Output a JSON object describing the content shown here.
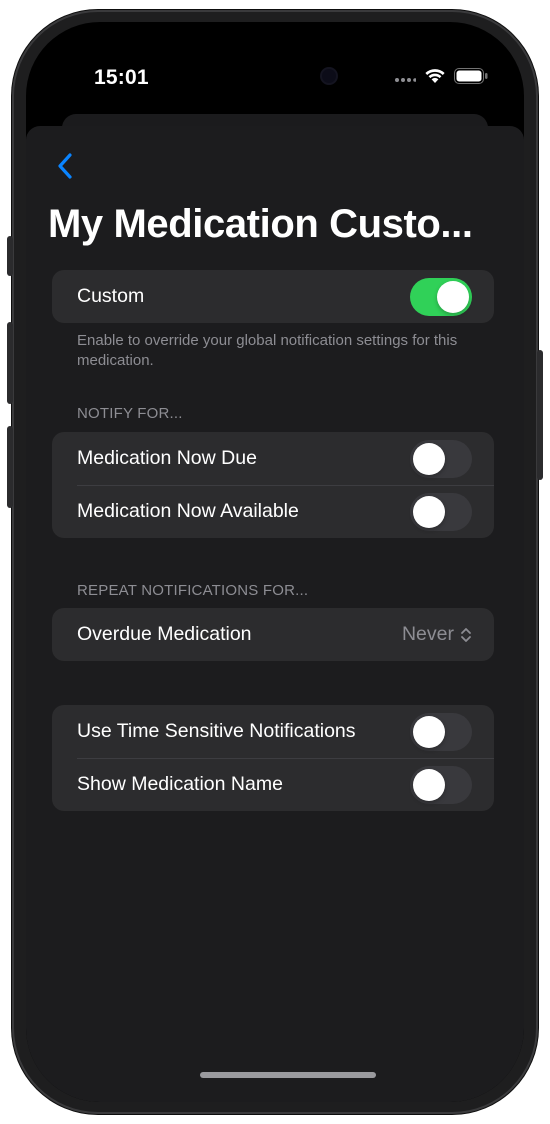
{
  "status_bar": {
    "time": "15:01",
    "icons": [
      "signal-icon",
      "wifi-icon",
      "battery-icon"
    ]
  },
  "nav": {
    "back_icon": "chevron-left-icon",
    "title": "My Medication Custo..."
  },
  "custom_section": {
    "label": "Custom",
    "enabled": true,
    "footnote": "Enable to override your global notification settings for this medication."
  },
  "notify_section": {
    "header": "NOTIFY FOR...",
    "items": [
      {
        "label": "Medication Now Due",
        "enabled": false
      },
      {
        "label": "Medication Now Available",
        "enabled": false
      }
    ]
  },
  "repeat_section": {
    "header": "REPEAT NOTIFICATIONS FOR...",
    "label": "Overdue Medication",
    "value": "Never"
  },
  "options_section": {
    "items": [
      {
        "label": "Use Time Sensitive Notifications",
        "enabled": false
      },
      {
        "label": "Show Medication Name",
        "enabled": false
      }
    ]
  },
  "colors": {
    "accent": "#0a84ff",
    "toggle_on": "#30d158",
    "toggle_off": "#39393d",
    "cell_background": "#2c2c2e",
    "sheet_background": "#1c1c1e",
    "secondary_text": "#8d8d93"
  }
}
